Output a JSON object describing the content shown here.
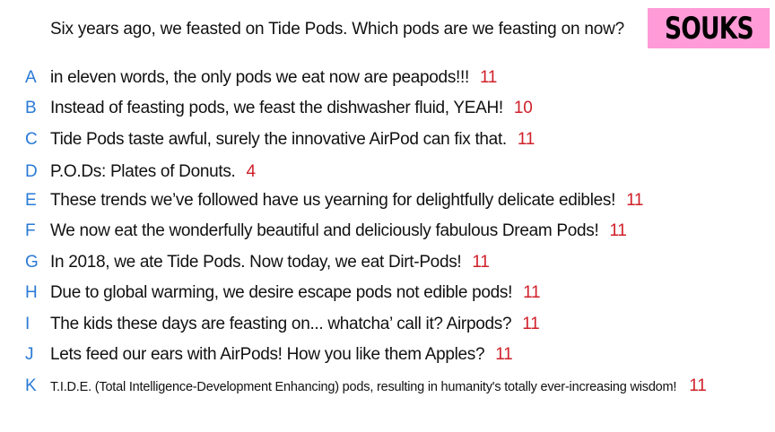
{
  "question": "Six years ago, we feasted on Tide Pods. Which pods are we feasting on now?",
  "logo": "SOUKS",
  "colors": {
    "letter": "#2a7ad6",
    "count": "#d0202a",
    "logo_bg": "#ff9bd7"
  },
  "answers": [
    {
      "letter": "A",
      "text": "in eleven words, the only pods we eat now are peapods!!!",
      "count": "11"
    },
    {
      "letter": "B",
      "text": "Instead of feasting pods, we feast the dishwasher fluid, YEAH!",
      "count": "10"
    },
    {
      "letter": "C",
      "text": "Tide Pods taste awful, surely the innovative AirPod can fix that.",
      "count": "11"
    },
    {
      "letter": "D",
      "text": "P.O.Ds: Plates of Donuts.",
      "count": "4"
    },
    {
      "letter": "E",
      "text": "These trends we’ve followed have us yearning for delightfully delicate edibles!",
      "count": "11"
    },
    {
      "letter": "F",
      "text": "We now eat the wonderfully beautiful and deliciously fabulous Dream Pods!",
      "count": "11"
    },
    {
      "letter": "G",
      "text": "In 2018, we ate Tide Pods. Now today, we eat Dirt-Pods!",
      "count": "11"
    },
    {
      "letter": "H",
      "text": "Due to global warming, we desire escape pods not edible pods!",
      "count": "11"
    },
    {
      "letter": "I",
      "text": "The kids these days are feasting on... whatcha’ call it? Airpods?",
      "count": "11"
    },
    {
      "letter": "J",
      "text": "Lets feed our ears with AirPods! How you like them Apples?",
      "count": "11"
    },
    {
      "letter": "K",
      "text": "T.I.D.E. (Total Intelligence-Development Enhancing) pods, resulting in humanity's totally ever-increasing wisdom!",
      "count": "11"
    }
  ]
}
